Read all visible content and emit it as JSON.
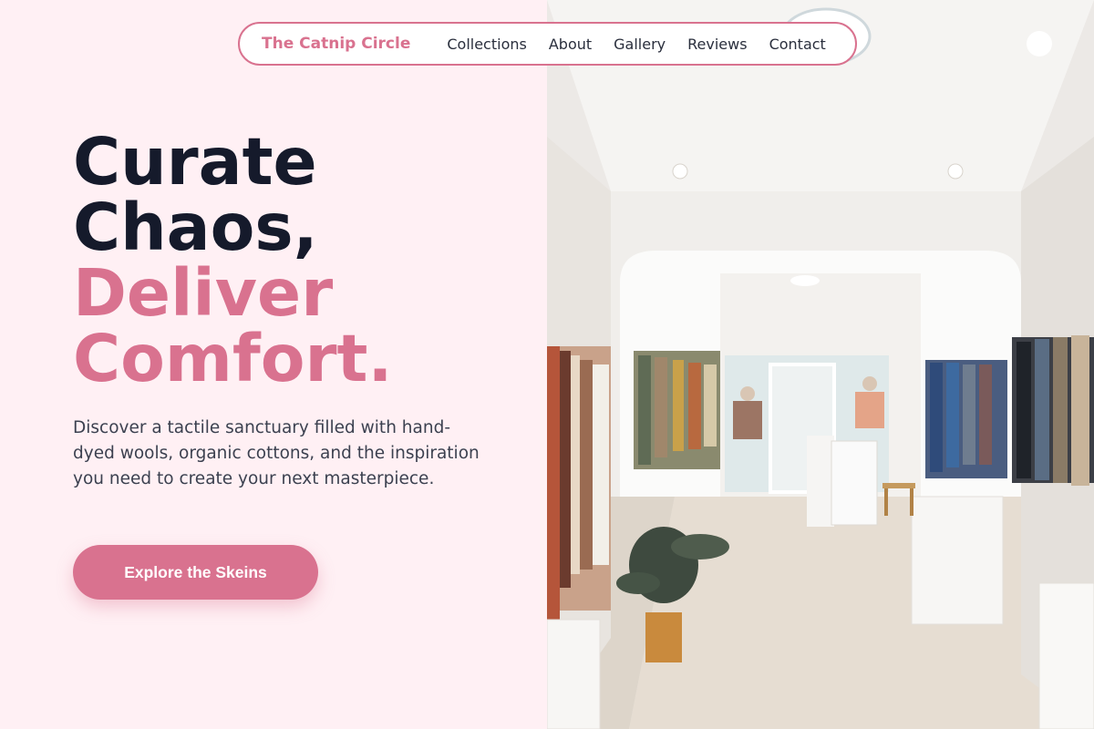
{
  "nav": {
    "brand": "The Catnip Circle",
    "links": [
      "Collections",
      "About",
      "Gallery",
      "Reviews",
      "Contact"
    ]
  },
  "hero": {
    "headline_dark": [
      "Curate",
      "Chaos,"
    ],
    "headline_pink": [
      "Deliver",
      "Comfort."
    ],
    "description": "Discover a tactile sanctuary filled with hand-dyed wools, organic cottons, and the inspiration you need to create your next masterpiece.",
    "cta_label": "Explore the Skeins"
  },
  "colors": {
    "accent": "#d9728f",
    "dark_text": "#151a2b",
    "background": "#fff0f4"
  }
}
